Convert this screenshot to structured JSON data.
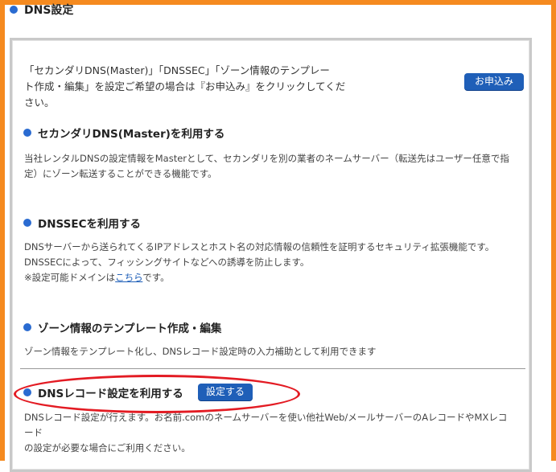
{
  "page": {
    "title": "DNS設定"
  },
  "intro": {
    "line1": "「セカンダリDNS(Master)」「DNSSEC」「ゾーン情報のテンプレー",
    "line2": "ト作成・編集」を設定ご希望の場合は『お申込み』をクリックしてくだ",
    "line3": "さい。",
    "apply_button": "お申込み"
  },
  "sections": [
    {
      "title": "セカンダリDNS(Master)を利用する",
      "desc_line1": "当社レンタルDNSの設定情報をMasterとして、セカンダリを別の業者のネームサーバー（転送先はユーザー任意で指",
      "desc_line2": "定）にゾーン転送することができる機能です。"
    },
    {
      "title": "DNSSECを利用する",
      "desc_line1": "DNSサーバーから送られてくるIPアドレスとホスト名の対応情報の信頼性を証明するセキュリティ拡張機能です。",
      "desc_line2": "DNSSECによって、フィッシングサイトなどへの誘導を防止します。",
      "desc_line3_prefix": "※設定可能ドメインは",
      "desc_link": "こちら",
      "desc_line3_suffix": "です。"
    },
    {
      "title": "ゾーン情報のテンプレート作成・編集",
      "desc_line1": "ゾーン情報をテンプレート化し、DNSレコード設定時の入力補助として利用できます"
    },
    {
      "title": "DNSレコード設定を利用する",
      "button": "設定する",
      "desc_line1": "DNSレコード設定が行えます。お名前.comのネームサーバーを使い他社Web/メールサーバーのAレコードやMXレコード",
      "desc_line2": "の設定が必要な場合にご利用ください。"
    }
  ],
  "colors": {
    "frame": "#f58a1f",
    "accent": "#1f5fb8",
    "bullet": "#2a6bd1",
    "highlight": "#e31b23"
  }
}
